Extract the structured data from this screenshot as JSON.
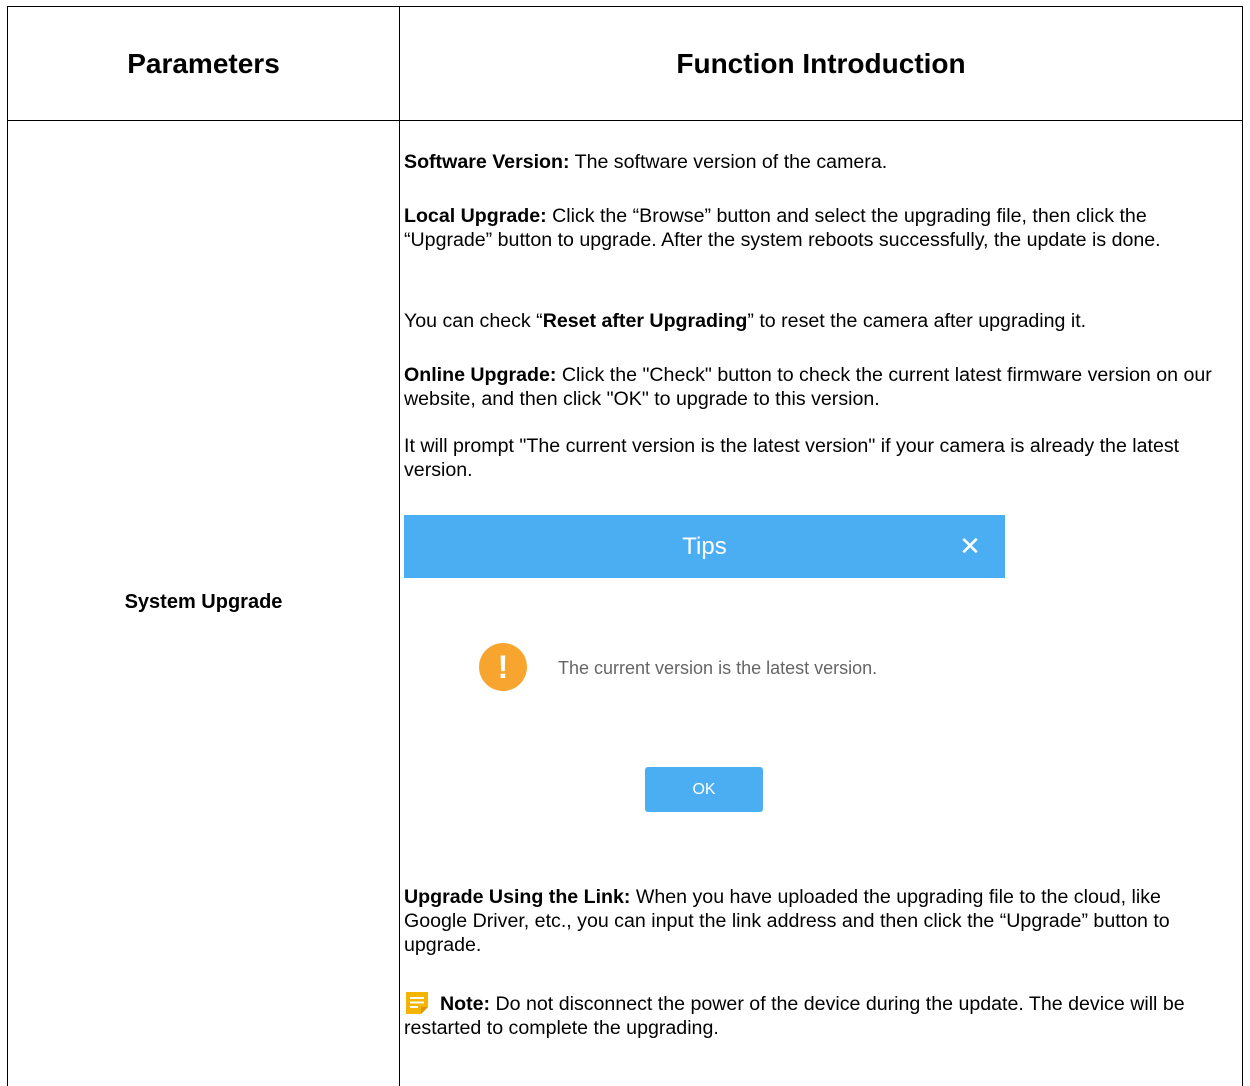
{
  "table": {
    "header_parameters": "Parameters",
    "header_function": "Function Introduction",
    "row": {
      "parameter": "System Upgrade",
      "software_version": {
        "label": "Software Version:",
        "text": " The software version of the camera."
      },
      "local_upgrade": {
        "label": "Local Upgrade:",
        "text": " Click the “Browse” button and select the upgrading file, then click the “Upgrade” button to upgrade. After the system reboots successfully, the update is done."
      },
      "reset_note": {
        "prefix": "You can check “",
        "bold": "Reset after Upgrading",
        "suffix": "” to reset the camera after upgrading it."
      },
      "online_upgrade": {
        "label": "Online Upgrade:",
        "text": " Click the \"Check\" button to check the current latest firmware version on our website, and then click \"OK\" to upgrade to this version."
      },
      "prompt_text": "It will prompt \"The current version is the latest version\" if your camera is already the latest version.",
      "dialog": {
        "title": "Tips",
        "close_glyph": "✕",
        "warning_glyph": "!",
        "message": "The current version is the latest version.",
        "ok_label": "OK",
        "header_color": "#4baef3",
        "warning_color": "#f7a52f"
      },
      "link_upgrade": {
        "label": "Upgrade Using the Link:",
        "text": " When you have uploaded the upgrading file to the cloud, like Google Driver, etc., you can input the link address and then click the “Upgrade” button to upgrade."
      },
      "note": {
        "icon": "note-icon",
        "label": "Note:",
        "text": "  Do not disconnect the power of the device during the update. The device will be restarted to complete the upgrading."
      }
    }
  }
}
